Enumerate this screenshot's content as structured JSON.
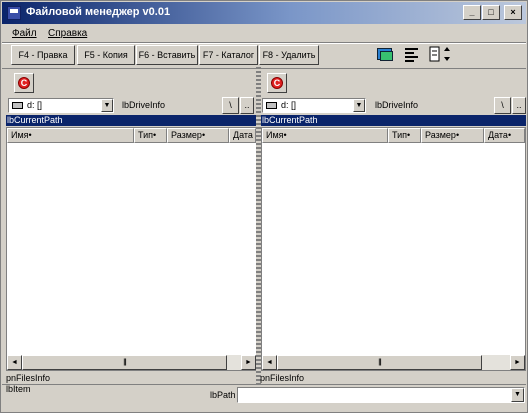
{
  "window": {
    "title": "Файловой менеджер v0.01",
    "controls": [
      "_",
      "□",
      "×"
    ]
  },
  "menu": [
    "Файл",
    "Справка"
  ],
  "function_keys": [
    "F4 - Правка",
    "F5 - Копия",
    "F6 - Вставить",
    "F7 - Каталог",
    "F8 - Удалить"
  ],
  "toolbar_icons": [
    "view-style-icon",
    "list-view-icon",
    "properties-icon",
    "spin-control"
  ],
  "stop_glyph": "C",
  "left_panel": {
    "drive": "d: []",
    "drive_info": "lbDriveInfo",
    "root_button": "\\",
    "up_button": "..",
    "current_path": "lbCurrentPath",
    "columns": [
      "Имя",
      "Тип",
      "Размер",
      "Дата"
    ],
    "files_info": "pnFilesInfo"
  },
  "right_panel": {
    "drive": "d: []",
    "drive_info": "lbDriveInfo",
    "root_button": "\\",
    "up_button": "..",
    "current_path": "lbCurrentPath",
    "columns": [
      "Имя",
      "Тип",
      "Размер",
      "Дата"
    ],
    "files_info": "pnFilesInfo"
  },
  "scroll": {
    "left_arrow": "◄",
    "right_arrow": "►",
    "thumb_grip": "|||"
  },
  "status": {
    "item_label": "lbItem",
    "path_label": "lbPath",
    "path_value": ""
  },
  "colors": {
    "titlebar_start": "#0a246a",
    "titlebar_end": "#bcc8dc",
    "selection": "#0a246a",
    "window_face": "#d4d0c8"
  }
}
